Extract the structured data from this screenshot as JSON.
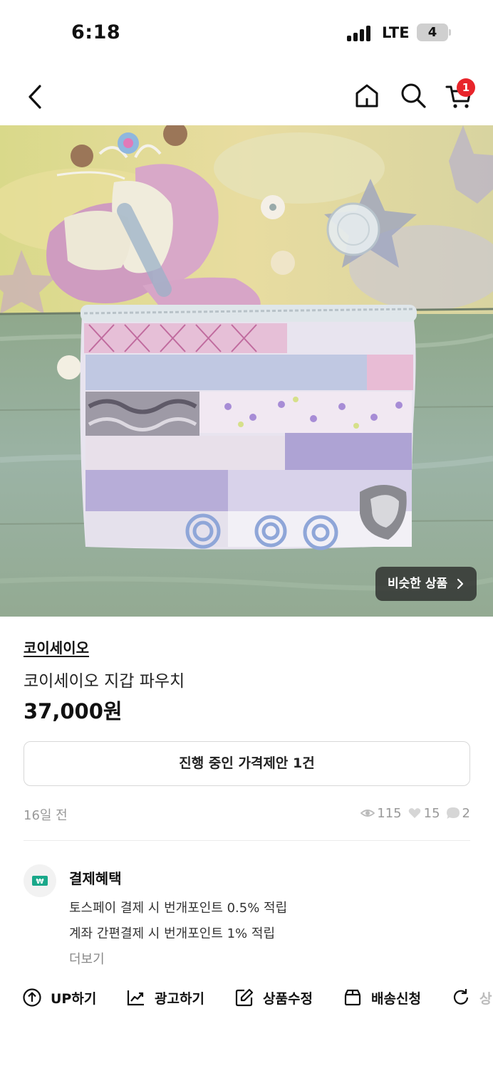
{
  "status_bar": {
    "time": "6:18",
    "network": "LTE",
    "battery": "4"
  },
  "nav": {
    "cart_badge": "1",
    "icons": [
      "back-arrow-icon",
      "home-icon",
      "search-icon",
      "cart-icon"
    ]
  },
  "image": {
    "similar_button": "비슷한 상품"
  },
  "product": {
    "shop_name": "코이세이오",
    "title": "코이세이오 지갑 파우치",
    "price": "37,000원",
    "offer_button": "진행 중인 가격제안 1건",
    "posted": "16일 전",
    "stats": {
      "views": "115",
      "likes": "15",
      "chats": "2"
    }
  },
  "benefits": {
    "title": "결제혜택",
    "line1": "토스페이 결제 시 번개포인트 0.5% 적립",
    "line2": "계좌 간편결제 시 번개포인트 1% 적립",
    "more": "더보기"
  },
  "actions": {
    "up": "UP하기",
    "ad": "광고하기",
    "edit": "상품수정",
    "shipping": "배송신청",
    "refresh_partial": "상"
  },
  "colors": {
    "badge_red": "#e8252b",
    "benefit_green": "#1aa88a",
    "muted_gray": "#999999"
  }
}
